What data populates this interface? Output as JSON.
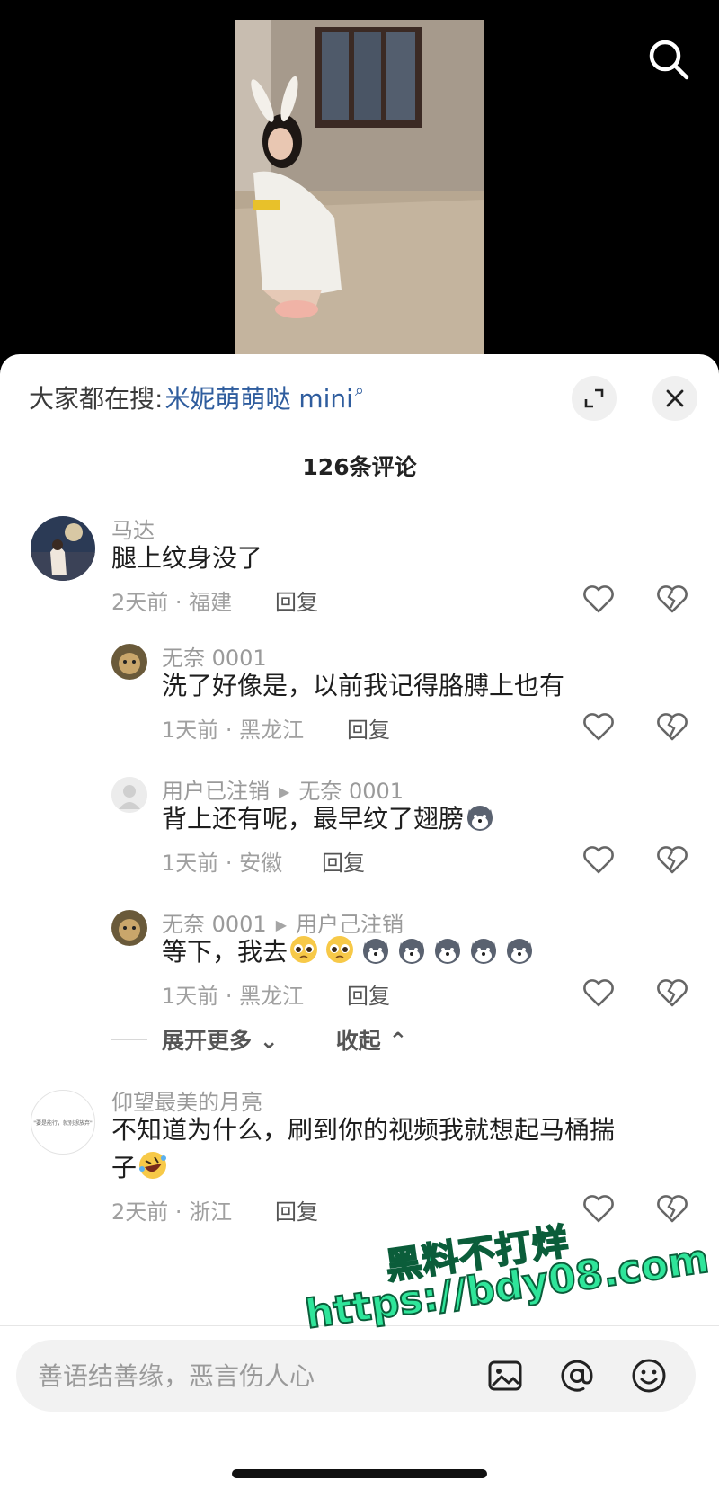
{
  "header": {
    "search_prefix": "大家都在搜:",
    "search_term": "米妮萌萌哒 mini"
  },
  "comment_count": "126条评论",
  "comments": [
    {
      "username": "马达",
      "text": "腿上纹身没了",
      "time": "2天前",
      "location": "福建",
      "meta": "2天前 · 福建",
      "reply_label": "回复"
    },
    {
      "username": "无奈 0001",
      "text": "洗了好像是，以前我记得胳膊上也有",
      "time": "1天前",
      "location": "黑龙江",
      "meta": "1天前 · 黑龙江",
      "reply_label": "回复"
    },
    {
      "username": "用户已注销",
      "reply_to": "无奈 0001",
      "text": "背上还有呢，最早纹了翅膀",
      "emoji": [
        "husky-emoji"
      ],
      "time": "1天前",
      "location": "安徽",
      "meta": "1天前 · 安徽",
      "reply_label": "回复"
    },
    {
      "username": "无奈 0001",
      "reply_to": "用户己注销",
      "text": "等下，我去",
      "emoji": [
        "pleading-face-emoji",
        "pleading-face-emoji",
        "husky-emoji",
        "husky-emoji",
        "husky-emoji",
        "husky-emoji",
        "husky-emoji"
      ],
      "time": "1天前",
      "location": "黑龙江",
      "meta": "1天前 · 黑龙江",
      "reply_label": "回复"
    },
    {
      "username": "仰望最美的月亮",
      "text_line1": "不知道为什么，刷到你的视频我就想起马桶揣",
      "text_line2": "子",
      "emoji": [
        "rofl-emoji"
      ],
      "time": "2天前",
      "location": "浙江",
      "meta": "2天前 · 浙江",
      "reply_label": "回复",
      "avatar_text": "\"要是能行，就别想放弃\""
    }
  ],
  "thread_controls": {
    "expand_more": "展开更多",
    "collapse": "收起"
  },
  "input": {
    "placeholder": "善语结善缘，恶言伤人心"
  },
  "watermark": {
    "line1": "黑料不打烊",
    "line2": "https://bdy08.com"
  },
  "colors": {
    "link_blue": "#2f5d9e",
    "watermark_green": "#2fe59a"
  },
  "icons": [
    "search-icon",
    "expand-icon",
    "close-icon",
    "heart-icon",
    "broken-heart-icon",
    "image-icon",
    "at-icon",
    "smiley-icon"
  ]
}
